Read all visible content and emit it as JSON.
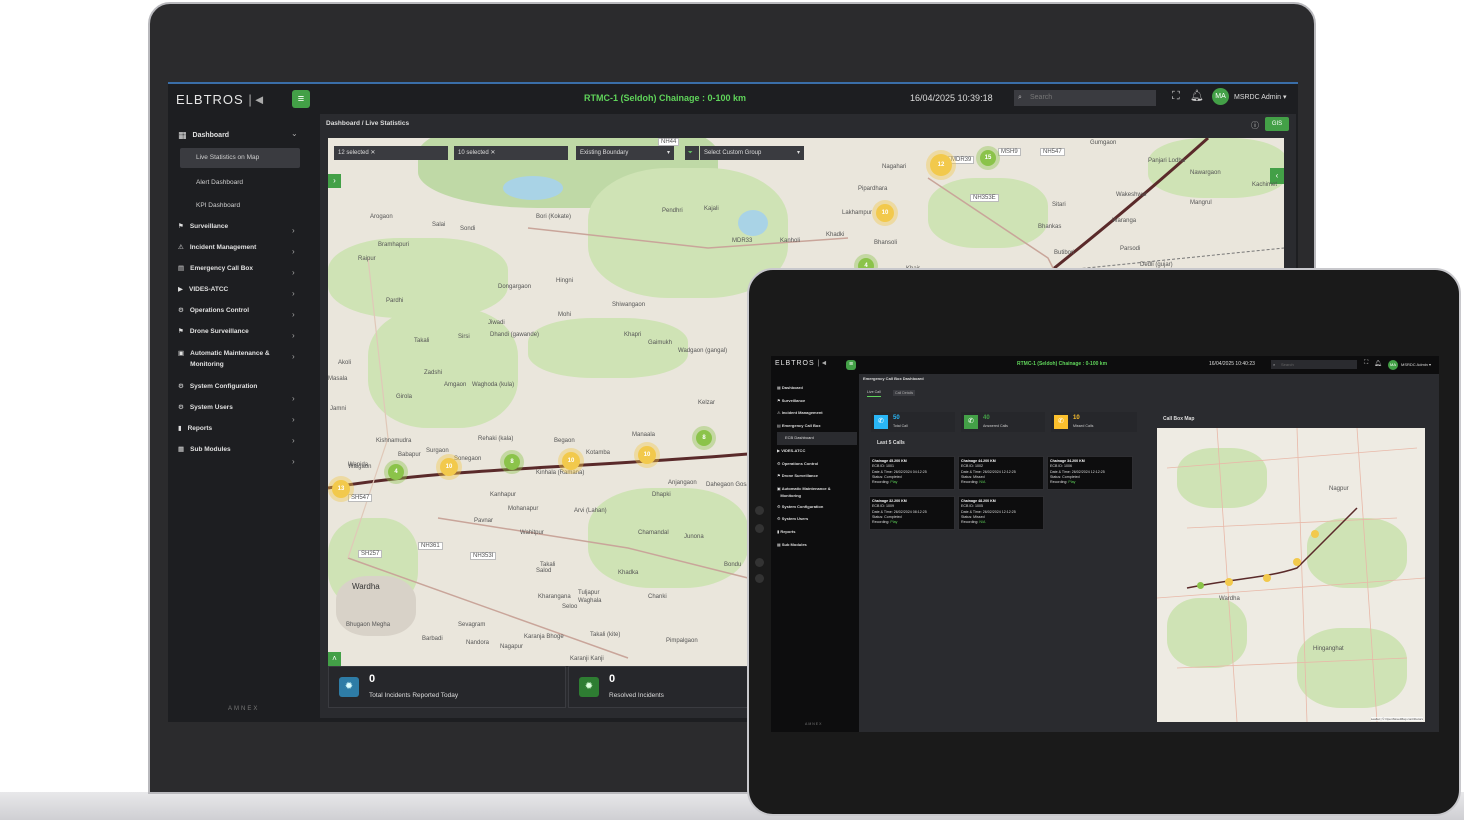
{
  "laptop": {
    "logo": "ELBTROS",
    "header_title": "RTMC-1 (Seldoh) Chainage : 0-100 km",
    "datetime": "16/04/2025 10:39:18",
    "search_placeholder": "Search",
    "user_initials": "MA",
    "user_name": "MSRDC Admin",
    "breadcrumb": "Dashboard / Live Statistics",
    "gis_label": "GIS",
    "sidebar": {
      "dashboard": "Dashboard",
      "sub_items": [
        "Live Statistics on Map",
        "Alert Dashboard",
        "KPI Dashboard"
      ],
      "items": [
        "Surveillance",
        "Incident Management",
        "Emergency Call Box",
        "VIDES-ATCC",
        "Operations Control",
        "Drone Surveillance",
        "Automatic Maintenance &",
        "Monitoring",
        "System Configuration",
        "System Users",
        "Reports",
        "Sub Modules"
      ],
      "footer": "AMNEX"
    },
    "filters": [
      "12 selected",
      "10 selected",
      "Existing Boundary",
      "Select Custom Group"
    ],
    "cards": [
      {
        "value": "0",
        "label": "Total Incidents Reported Today"
      },
      {
        "value": "0",
        "label": "Resolved Incidents"
      }
    ],
    "map_labels": [
      "Arogaon",
      "Salai",
      "Sondi",
      "Bori (Kokate)",
      "Pendhri",
      "Kajali",
      "Raipur",
      "Dongargaon",
      "Hingni",
      "Shiwangaon",
      "Jiwadi",
      "Dhandi (gawande)",
      "Mohi",
      "Khapri",
      "Gaimukh",
      "Wadgaon (gangal)",
      "Takali",
      "Zadshi",
      "Amgaon",
      "Waghoda (kula)",
      "Girola",
      "Rehaki (kala)",
      "Begaon",
      "Kotamba",
      "Manaala",
      "Kelzar",
      "Surgaon",
      "Babapur",
      "Waigaon",
      "Sonegaon",
      "Kinhala (Ramana)",
      "Dahegaon Gosavi",
      "Anjangaon",
      "Dhapki",
      "Kanhapur",
      "Mohanapur",
      "Arvi (Lahan)",
      "Chamandal",
      "Junona",
      "Pavnar",
      "Wahitpur",
      "Wardha",
      "Takali",
      "Khadka",
      "Karanja Bhoge",
      "Seloo",
      "Chanki",
      "Sevagram",
      "Nagapur",
      "Barbadi",
      "Nandora",
      "Pimpalgaon",
      "Karanji Kanji",
      "Nagahari",
      "Pipardhara",
      "Lakhampur",
      "Kanholi",
      "Khadki",
      "Bhansoli",
      "Gumgaon",
      "Panjari Lodha",
      "Nawargaon",
      "Kachimet",
      "Wakeshwar",
      "Waranga",
      "Mangrul",
      "Bhankas",
      "Sitari",
      "Parsodi",
      "Dedli (gujar)",
      "Butibori",
      "Khair",
      "Akoli",
      "Masala",
      "Jamni",
      "Kishnamudra",
      "Wanida",
      "Pardhi",
      "Sirsi",
      "Bramhapuri",
      "Salod",
      "Bondu",
      "Tuljapur",
      "Kharangana",
      "Waghala",
      "Takali (kite)",
      "Bhugaon Megha"
    ],
    "road_labels": [
      "NH44",
      "MDR33",
      "NH353E",
      "SH257",
      "NH361",
      "NH353I",
      "MSH9",
      "SH547",
      "MDR39",
      "NH547"
    ],
    "marker_values": [
      "12",
      "10",
      "15",
      "4",
      "10",
      "8",
      "10",
      "10",
      "8",
      "13",
      "8",
      "4"
    ]
  },
  "tablet": {
    "logo": "ELBTROS",
    "header_title": "RTMC-1 (Seldoh) Chainage : 0-100 km",
    "datetime": "16/04/2025 10:40:23",
    "search_placeholder": "Search",
    "user_initials": "MA",
    "user_name": "MSRDC Admin",
    "breadcrumb": "Emergency Call Box Dashboard",
    "tabs": [
      "Live Call",
      "Call Details"
    ],
    "sidebar_items": [
      "Dashboard",
      "Surveillance",
      "Incident Management",
      "Emergency Call Box",
      "ECB Dashboard",
      "VIDES-ATCC",
      "Operations Control",
      "Drone Surveillance",
      "Automatic Maintenance &",
      "Monitoring",
      "System Configuration",
      "System Users",
      "Reports",
      "Sub Modules"
    ],
    "footer": "AMNEX",
    "stats": [
      {
        "value": "50",
        "label": "Total Call",
        "color": "#29b6f6"
      },
      {
        "value": "40",
        "label": "Answered Calls",
        "color": "#43a047"
      },
      {
        "value": "10",
        "label": "Missed Calls",
        "color": "#fbc02d"
      }
    ],
    "last_calls_title": "Last 5 Calls",
    "calls": [
      {
        "title": "Chainage 45.200 KM",
        "ecb": "ECB ID: 1001",
        "dt": "Date & Time: 26/02/2024 04:12:25",
        "status": "Status: Completed",
        "rec": "Recording:",
        "play": "Play"
      },
      {
        "title": "Chainage 44.200 KM",
        "ecb": "ECB ID: 1002",
        "dt": "Date & Time: 26/02/2024 12:12:25",
        "status": "Status: Missed",
        "rec": "Recording:",
        "play": "N/A"
      },
      {
        "title": "Chainage 34.200 KM",
        "ecb": "ECB ID: 1006",
        "dt": "Date & Time: 26/02/2024 12:12:25",
        "status": "Status: Completed",
        "rec": "Recording:",
        "play": "Play"
      },
      {
        "title": "Chainage 32.200 KM",
        "ecb": "ECB ID: 1009",
        "dt": "Date & Time: 26/02/2024 08:12:25",
        "status": "Status: Completed",
        "rec": "Recording:",
        "play": "Play"
      },
      {
        "title": "Chainage 48.200 KM",
        "ecb": "ECB ID: 1005",
        "dt": "Date & Time: 26/02/2024 12:12:25",
        "status": "Status: Missed",
        "rec": "Recording:",
        "play": "N/A"
      }
    ],
    "map_title": "Call Box Map",
    "map_labels": [
      "Nagpur",
      "Wardha",
      "Hinganghat"
    ],
    "attribution": "Leaflet | © OpenStreetMap contributors"
  },
  "colors": {
    "accent_green": "#43a047",
    "header_green": "#5fd35a",
    "marker_yellow": "#f2c94c",
    "marker_green": "#8bc34a",
    "route": "#5a2a2a"
  }
}
